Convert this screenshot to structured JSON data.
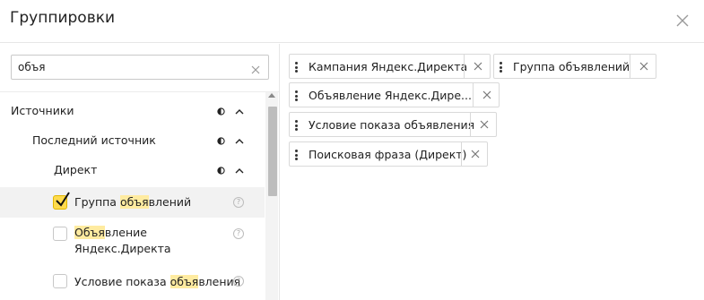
{
  "dialog": {
    "title": "Группировки"
  },
  "search": {
    "value": "объя",
    "placeholder": ""
  },
  "tree": {
    "sources_label": "Источники",
    "last_source_label": "Последний источник",
    "direct_label": "Директ",
    "items": [
      {
        "before": "Группа ",
        "match": "объя",
        "after": "влений",
        "checked": true
      },
      {
        "before": "",
        "match": "Объя",
        "after": "вление",
        "line2": "Яндекс.Директа",
        "checked": false
      },
      {
        "before": "Условие показа ",
        "match": "объя",
        "after": "вления",
        "checked": false
      }
    ]
  },
  "chips": [
    {
      "label": "Кампания Яндекс.Директа"
    },
    {
      "label": "Группа объявлений"
    },
    {
      "label": "Объявление Яндекс.Дире..."
    },
    {
      "label": "Условие показа объявления"
    },
    {
      "label": "Поисковая фраза (Директ)"
    }
  ],
  "colors": {
    "checkbox_checked": "#ffdb4d",
    "highlight": "#ffeba0",
    "selected_row": "#f2f2f2"
  }
}
